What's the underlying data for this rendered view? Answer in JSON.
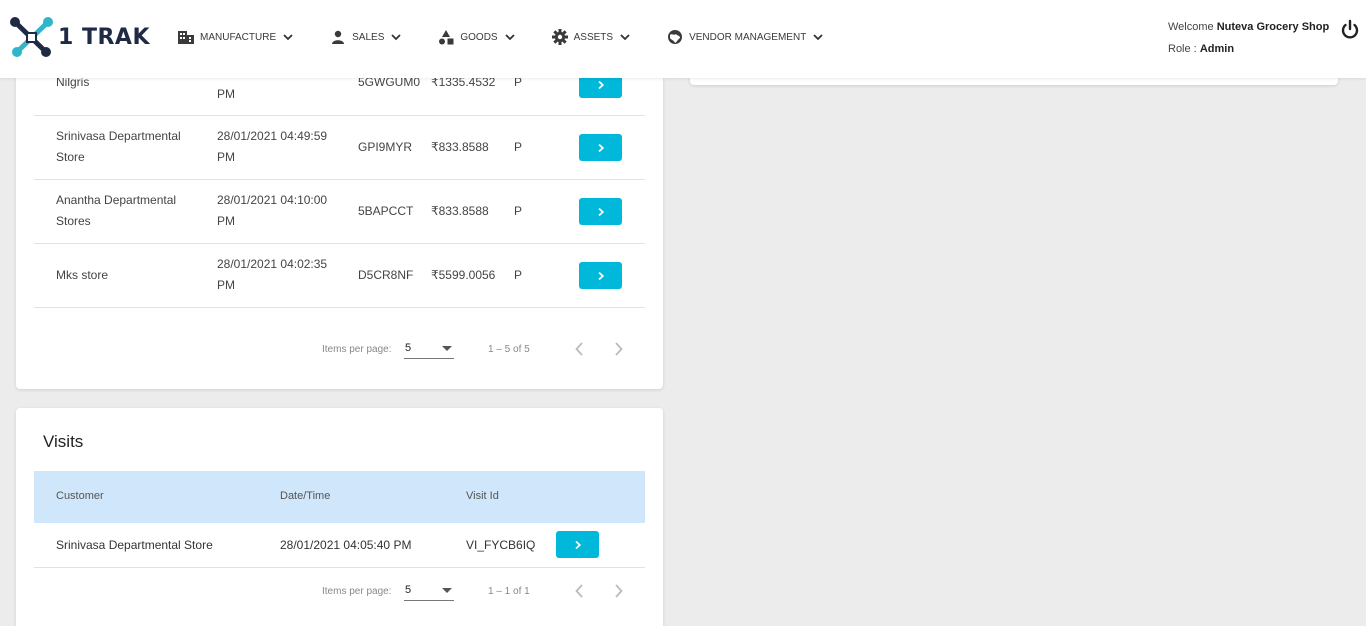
{
  "header": {
    "logo_text": "1 TRAK",
    "nav": [
      {
        "label": "MANUFACTURE",
        "icon": "building-icon"
      },
      {
        "label": "SALES",
        "icon": "person-icon"
      },
      {
        "label": "GOODS",
        "icon": "shapes-icon"
      },
      {
        "label": "ASSETS",
        "icon": "gear-icon"
      },
      {
        "label": "VENDOR MANAGEMENT",
        "icon": "globe-icon"
      }
    ],
    "welcome_prefix": "Welcome",
    "user_name": "Nuteva Grocery Shop",
    "role_prefix": "Role :",
    "role": "Admin"
  },
  "orders": {
    "rows": [
      {
        "customer": "Nilgris",
        "datetime": "PM",
        "order_id": "5GWGUM0",
        "amount": "₹1335.4532",
        "status": "P"
      },
      {
        "customer": "Srinivasa Departmental Store",
        "datetime": "28/01/2021 04:49:59 PM",
        "order_id": "GPI9MYR",
        "amount": "₹833.8588",
        "status": "P"
      },
      {
        "customer": "Anantha Departmental Stores",
        "datetime": "28/01/2021 04:10:00 PM",
        "order_id": "5BAPCCT",
        "amount": "₹833.8588",
        "status": "P"
      },
      {
        "customer": "Mks store",
        "datetime": "28/01/2021 04:02:35 PM",
        "order_id": "D5CR8NF",
        "amount": "₹5599.0056",
        "status": "P"
      }
    ],
    "pager": {
      "items_per_page_label": "Items per page:",
      "items_per_page": "5",
      "range": "1 – 5 of 5"
    }
  },
  "visits": {
    "title": "Visits",
    "columns": [
      "Customer",
      "Date/Time",
      "Visit Id"
    ],
    "rows": [
      {
        "customer": "Srinivasa Departmental Store",
        "datetime": "28/01/2021 04:05:40 PM",
        "visit_id": "VI_FYCB6IQ"
      }
    ],
    "pager": {
      "items_per_page_label": "Items per page:",
      "items_per_page": "5",
      "range": "1 – 1 of 1"
    }
  },
  "colors": {
    "accent": "#00b8d9",
    "table_header": "#cfe6fb",
    "background": "#ececec"
  }
}
